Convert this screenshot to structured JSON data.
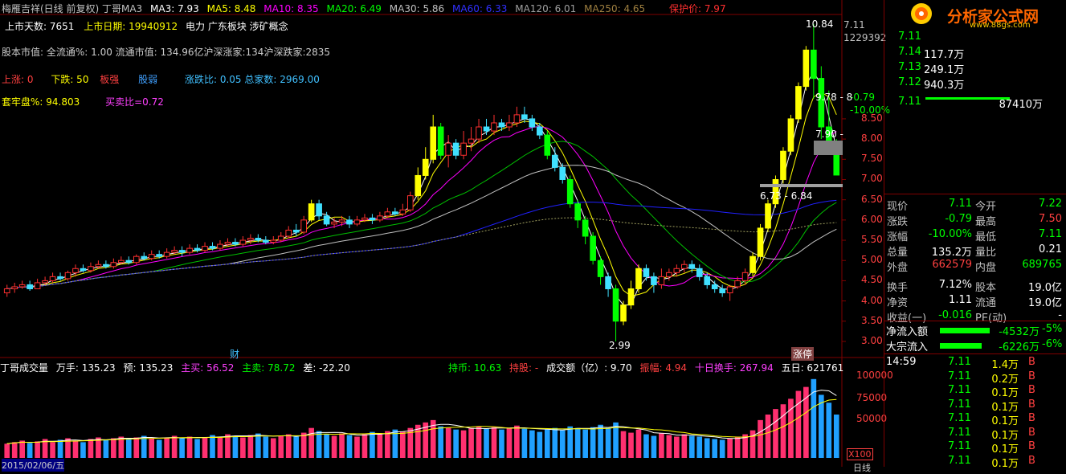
{
  "header": {
    "title": "梅雁吉祥(日线 前复权) 丁哥MA3",
    "ma3": "MA3: 7.93",
    "ma5": "MA5: 8.48",
    "ma10": "MA10: 8.35",
    "ma20": "MA20: 6.49",
    "ma30": "MA30: 5.86",
    "ma60": "MA60: 6.33",
    "ma120": "MA120: 6.01",
    "ma250": "MA250: 4.65",
    "protect": "保护价: 7.97"
  },
  "info": {
    "listdays": "上市天数: 7651",
    "listdate": "上市日期: 19940912",
    "concept": "电力 广东板块 涉矿概念",
    "capital": "股本市值: 全流通%: 1.00 流通市值: 134.96亿沪深涨家:134沪深跌家:2835",
    "up": "上涨: 0",
    "down": "下跌: 50",
    "strong": "板强",
    "weak": "股弱",
    "ratio": "涨跌比: 0.05 总家数: 2969.00",
    "trap": "套牢盘%: 94.803",
    "bsratio": "买卖比=0.72"
  },
  "price_axis": {
    "top_value": "7.11",
    "volume_value": "1229392",
    "change": "-0.79",
    "change_pct": "-10.00%",
    "labels": [
      "8.50",
      "8.00",
      "7.50",
      "7.00",
      "6.50",
      "6.00",
      "5.50",
      "5.00",
      "4.50",
      "4.00",
      "3.50",
      "3.00"
    ],
    "extra": [
      "1",
      "9",
      "8"
    ]
  },
  "annotations": {
    "high": "10.84",
    "low": "2.99",
    "mid1": "9.78 - 8",
    "mid2": "7.90 -",
    "range": "6.73 - 6.84",
    "cai": "财",
    "zhangting": "涨停"
  },
  "volume_header": {
    "title": "丁哥成交量",
    "wanshou": "万手: 135.23",
    "yu": "预: 135.23",
    "zhumai": "主买: 56.52",
    "zhumai2": "主卖: 78.72",
    "cha": "差: -22.20",
    "chibi": "持币: 10.63",
    "chigu": "持股: -",
    "amount": "成交额（亿）: 9.70",
    "zhenfu": "振幅: 4.94",
    "turnover": "十日换手: 267.94",
    "wuri": "五日: 621761"
  },
  "volume_axis": {
    "labels": [
      "100000",
      "75000",
      "50000"
    ],
    "unit": "X100",
    "date": "2015/02/06/五",
    "rixian": "日线"
  },
  "logo": {
    "name": "分析家公式网",
    "url": "www.88gs.com"
  },
  "order_book": [
    {
      "price": "7.11",
      "vol": ""
    },
    {
      "price": "7.14",
      "vol": "117.7万"
    },
    {
      "price": "7.13",
      "vol": "249.1万"
    },
    {
      "price": "7.12",
      "vol": "940.3万"
    },
    {
      "price": "7.11",
      "vol": "87410万"
    }
  ],
  "quote": [
    {
      "k1": "现价",
      "v1": "7.11",
      "k2": "今开",
      "v2": "7.22"
    },
    {
      "k1": "涨跌",
      "v1": "-0.79",
      "k2": "最高",
      "v2": "7.50"
    },
    {
      "k1": "涨幅",
      "v1": "-10.00%",
      "k2": "最低",
      "v2": "7.11"
    },
    {
      "k1": "总量",
      "v1": "135.2万",
      "k2": "量比",
      "v2": "0.21"
    },
    {
      "k1": "外盘",
      "v1": "662579",
      "k2": "内盘",
      "v2": "689765"
    },
    {
      "k1": "换手",
      "v1": "7.12%",
      "k2": "股本",
      "v2": "19.0亿"
    },
    {
      "k1": "净资",
      "v1": "1.11",
      "k2": "流通",
      "v2": "19.0亿"
    },
    {
      "k1": "收益(一)",
      "v1": "-0.016",
      "k2": "PE(动)",
      "v2": "-"
    }
  ],
  "flows": [
    {
      "label": "净流入额",
      "value": "-4532万",
      "pct": "-5%"
    },
    {
      "label": "大宗流入",
      "value": "-6226万",
      "pct": "-6%"
    }
  ],
  "ticks": [
    {
      "time": "14:59",
      "price": "7.11",
      "vol": "1.4万",
      "side": "B"
    },
    {
      "time": "",
      "price": "7.11",
      "vol": "0.2万",
      "side": "B"
    },
    {
      "time": "",
      "price": "7.11",
      "vol": "0.1万",
      "side": "B"
    },
    {
      "time": "",
      "price": "7.11",
      "vol": "0.1万",
      "side": "B"
    },
    {
      "time": "",
      "price": "7.11",
      "vol": "0.1万",
      "side": "B"
    },
    {
      "time": "",
      "price": "7.11",
      "vol": "0.1万",
      "side": "B"
    },
    {
      "time": "",
      "price": "7.11",
      "vol": "0.1万",
      "side": "B"
    },
    {
      "time": "",
      "price": "7.11",
      "vol": "0.1万",
      "side": "B"
    }
  ],
  "chart_data": {
    "type": "candlestick",
    "ylim": [
      2.9,
      11.0
    ],
    "candles": [
      [
        4.2,
        4.3,
        4.1,
        4.4
      ],
      [
        4.3,
        4.35,
        4.2,
        4.45
      ],
      [
        4.35,
        4.4,
        4.3,
        4.5
      ],
      [
        4.4,
        4.3,
        4.25,
        4.5
      ],
      [
        4.3,
        4.45,
        4.3,
        4.55
      ],
      [
        4.45,
        4.5,
        4.4,
        4.6
      ],
      [
        4.5,
        4.6,
        4.45,
        4.7
      ],
      [
        4.6,
        4.55,
        4.5,
        4.7
      ],
      [
        4.55,
        4.7,
        4.5,
        4.75
      ],
      [
        4.7,
        4.8,
        4.6,
        4.9
      ],
      [
        4.8,
        4.75,
        4.7,
        4.9
      ],
      [
        4.75,
        4.85,
        4.7,
        4.95
      ],
      [
        4.85,
        4.9,
        4.8,
        5.0
      ],
      [
        4.9,
        4.85,
        4.8,
        5.0
      ],
      [
        4.85,
        4.95,
        4.8,
        5.05
      ],
      [
        4.95,
        5.0,
        4.9,
        5.1
      ],
      [
        5.0,
        4.95,
        4.9,
        5.1
      ],
      [
        4.95,
        5.1,
        4.9,
        5.15
      ],
      [
        5.1,
        5.05,
        5.0,
        5.2
      ],
      [
        5.05,
        5.15,
        5.0,
        5.25
      ],
      [
        5.15,
        5.1,
        5.05,
        5.25
      ],
      [
        5.1,
        5.2,
        5.05,
        5.3
      ],
      [
        5.2,
        5.25,
        5.15,
        5.35
      ],
      [
        5.25,
        5.2,
        5.1,
        5.35
      ],
      [
        5.2,
        5.3,
        5.15,
        5.4
      ],
      [
        5.3,
        5.25,
        5.2,
        5.4
      ],
      [
        5.25,
        5.35,
        5.2,
        5.45
      ],
      [
        5.35,
        5.3,
        5.25,
        5.45
      ],
      [
        5.3,
        5.4,
        5.25,
        5.5
      ],
      [
        5.4,
        5.45,
        5.35,
        5.55
      ],
      [
        5.45,
        5.4,
        5.35,
        5.55
      ],
      [
        5.4,
        5.5,
        5.35,
        5.6
      ],
      [
        5.5,
        5.55,
        5.4,
        5.65
      ],
      [
        5.55,
        5.5,
        5.45,
        5.65
      ],
      [
        5.5,
        5.45,
        5.4,
        5.6
      ],
      [
        5.45,
        5.5,
        5.4,
        5.6
      ],
      [
        5.5,
        5.6,
        5.45,
        5.7
      ],
      [
        5.6,
        5.75,
        5.55,
        5.85
      ],
      [
        5.75,
        5.7,
        5.6,
        5.9
      ],
      [
        5.7,
        6.0,
        5.65,
        6.1
      ],
      [
        6.0,
        6.4,
        5.95,
        6.5
      ],
      [
        6.4,
        6.1,
        6.0,
        6.5
      ],
      [
        6.1,
        5.9,
        5.85,
        6.2
      ],
      [
        5.9,
        5.95,
        5.8,
        6.05
      ],
      [
        5.95,
        6.0,
        5.85,
        6.1
      ],
      [
        6.0,
        5.9,
        5.8,
        6.1
      ],
      [
        5.9,
        6.0,
        5.85,
        6.1
      ],
      [
        6.0,
        6.05,
        5.95,
        6.15
      ],
      [
        6.05,
        6.0,
        5.9,
        6.15
      ],
      [
        6.0,
        6.1,
        5.95,
        6.2
      ],
      [
        6.1,
        6.2,
        6.05,
        6.3
      ],
      [
        6.2,
        6.15,
        6.1,
        6.3
      ],
      [
        6.15,
        6.25,
        6.1,
        6.4
      ],
      [
        6.25,
        6.6,
        6.2,
        6.7
      ],
      [
        6.6,
        7.1,
        6.5,
        7.3
      ],
      [
        7.1,
        7.5,
        7.0,
        7.8
      ],
      [
        7.5,
        8.3,
        7.4,
        8.6
      ],
      [
        8.3,
        7.6,
        7.5,
        8.4
      ],
      [
        7.6,
        7.9,
        7.3,
        8.1
      ],
      [
        7.9,
        7.6,
        7.5,
        8.0
      ],
      [
        7.6,
        7.9,
        7.5,
        8.2
      ],
      [
        7.9,
        8.0,
        7.7,
        8.3
      ],
      [
        8.0,
        8.3,
        7.9,
        8.5
      ],
      [
        8.3,
        8.2,
        8.1,
        8.5
      ],
      [
        8.2,
        8.4,
        8.1,
        8.6
      ],
      [
        8.4,
        8.3,
        8.2,
        8.5
      ],
      [
        8.3,
        8.4,
        8.2,
        8.6
      ],
      [
        8.4,
        8.6,
        8.3,
        8.8
      ],
      [
        8.6,
        8.5,
        8.4,
        8.8
      ],
      [
        8.5,
        8.3,
        8.2,
        8.6
      ],
      [
        8.3,
        8.1,
        8.0,
        8.4
      ],
      [
        8.1,
        7.6,
        7.5,
        8.2
      ],
      [
        7.6,
        7.3,
        7.2,
        7.8
      ],
      [
        7.3,
        7.0,
        6.9,
        7.4
      ],
      [
        7.0,
        6.4,
        6.3,
        7.1
      ],
      [
        6.4,
        6.0,
        5.8,
        6.5
      ],
      [
        6.0,
        5.6,
        5.4,
        6.1
      ],
      [
        5.6,
        5.0,
        4.9,
        5.7
      ],
      [
        5.0,
        4.6,
        4.4,
        5.1
      ],
      [
        4.6,
        4.3,
        4.1,
        4.7
      ],
      [
        4.3,
        3.5,
        3.0,
        4.4
      ],
      [
        3.5,
        3.9,
        3.4,
        4.0
      ],
      [
        3.9,
        4.3,
        3.8,
        4.5
      ],
      [
        4.3,
        4.8,
        4.2,
        4.9
      ],
      [
        4.8,
        4.6,
        4.5,
        4.9
      ],
      [
        4.6,
        4.4,
        4.2,
        4.7
      ],
      [
        4.4,
        4.6,
        4.3,
        4.8
      ],
      [
        4.6,
        4.7,
        4.5,
        4.8
      ],
      [
        4.7,
        4.8,
        4.6,
        4.9
      ],
      [
        4.8,
        4.9,
        4.7,
        5.0
      ],
      [
        4.9,
        4.8,
        4.7,
        5.0
      ],
      [
        4.8,
        4.6,
        4.5,
        4.9
      ],
      [
        4.6,
        4.4,
        4.3,
        4.7
      ],
      [
        4.4,
        4.3,
        4.2,
        4.5
      ],
      [
        4.3,
        4.2,
        4.1,
        4.4
      ],
      [
        4.2,
        4.35,
        4.0,
        4.4
      ],
      [
        4.35,
        4.5,
        4.3,
        4.6
      ],
      [
        4.5,
        4.7,
        4.4,
        4.8
      ],
      [
        4.7,
        5.1,
        4.6,
        5.2
      ],
      [
        5.1,
        5.8,
        5.0,
        5.9
      ],
      [
        5.8,
        6.4,
        5.7,
        6.5
      ],
      [
        6.4,
        7.0,
        6.3,
        7.1
      ],
      [
        7.0,
        7.7,
        6.9,
        7.8
      ],
      [
        7.7,
        8.5,
        7.6,
        8.6
      ],
      [
        8.5,
        9.3,
        8.4,
        9.4
      ],
      [
        9.3,
        10.2,
        9.2,
        10.3
      ],
      [
        10.2,
        9.5,
        9.0,
        10.84
      ],
      [
        9.5,
        8.3,
        8.0,
        9.8
      ],
      [
        8.3,
        7.9,
        7.8,
        9.2
      ],
      [
        7.9,
        7.11,
        7.11,
        8.0
      ]
    ],
    "volume_ylim": [
      0,
      110000
    ],
    "volume": [
      18000,
      20000,
      22000,
      19000,
      21000,
      24000,
      20000,
      23000,
      25000,
      22000,
      20000,
      24000,
      26000,
      23000,
      25000,
      27000,
      24000,
      26000,
      28000,
      25000,
      23000,
      26000,
      28000,
      25000,
      27000,
      24000,
      26000,
      29000,
      27000,
      30000,
      28000,
      26000,
      29000,
      31000,
      27000,
      25000,
      28000,
      30000,
      27000,
      32000,
      38000,
      34000,
      30000,
      28000,
      31000,
      29000,
      27000,
      30000,
      33000,
      31000,
      34000,
      36000,
      33000,
      38000,
      42000,
      45000,
      48000,
      40000,
      38000,
      36000,
      35000,
      38000,
      40000,
      37000,
      39000,
      36000,
      38000,
      41000,
      37000,
      35000,
      33000,
      36000,
      38000,
      35000,
      40000,
      38000,
      36000,
      39000,
      42000,
      38000,
      45000,
      34000,
      32000,
      36000,
      30000,
      28000,
      31000,
      29000,
      27000,
      30000,
      28000,
      27000,
      25000,
      24000,
      23000,
      25000,
      27000,
      30000,
      35000,
      48000,
      55000,
      62000,
      68000,
      75000,
      85000,
      90000,
      100000,
      80000,
      70000,
      55000
    ]
  }
}
